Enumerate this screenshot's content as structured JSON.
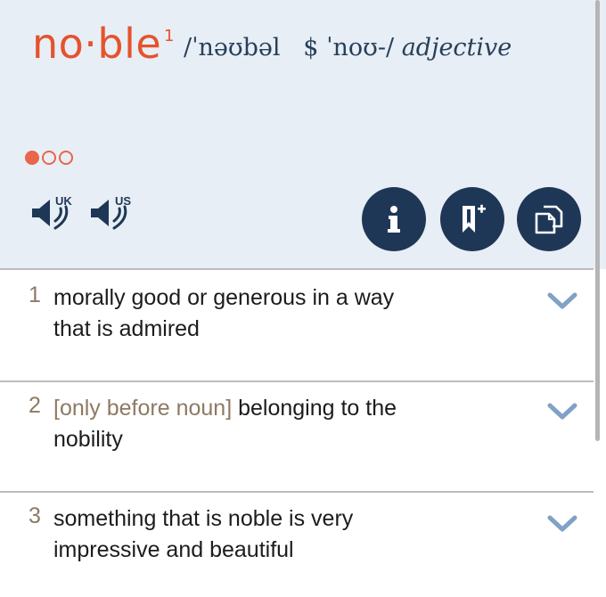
{
  "entry": {
    "headword": "no·ble",
    "homograph": "1",
    "pron_uk": "/ˈnəʊbəl",
    "pron_sep": "$",
    "pron_us": "ˈnoʊ-/",
    "pos": "adjective"
  },
  "frequency": {
    "level": 1,
    "max": 3
  },
  "audio": {
    "uk_label": "UK",
    "us_label": "US"
  },
  "actions": {
    "info_icon": "info-icon",
    "bookmark_icon": "bookmark-add-icon",
    "copy_icon": "copy-icon"
  },
  "senses": [
    {
      "num": "1",
      "gram": "",
      "text": "morally good or generous in a way that is admired"
    },
    {
      "num": "2",
      "gram": "[only before noun]",
      "text": "belonging to the nobility"
    },
    {
      "num": "3",
      "gram": "",
      "text": "something that is noble is very impressive and beautiful"
    }
  ],
  "colors": {
    "accent": "#e5532c",
    "header_bg": "#e8eef6",
    "button_bg": "#1f3756",
    "chevron": "#7fa2c6",
    "grammar": "#8e7a63"
  }
}
